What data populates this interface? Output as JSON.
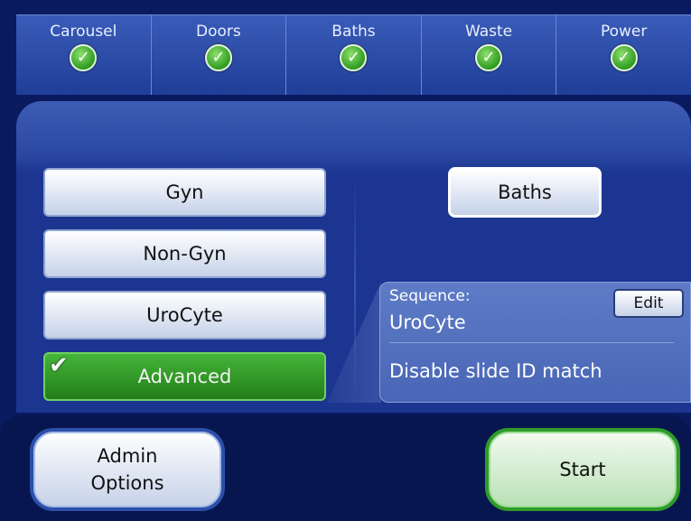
{
  "status_bar": {
    "items": [
      {
        "label": "Carousel",
        "status_icon": "check-circle-icon",
        "status_color": "#2f9b1f"
      },
      {
        "label": "Doors",
        "status_icon": "check-circle-icon",
        "status_color": "#2f9b1f"
      },
      {
        "label": "Baths",
        "status_icon": "check-circle-icon",
        "status_color": "#2f9b1f"
      },
      {
        "label": "Waste",
        "status_icon": "check-circle-icon",
        "status_color": "#2f9b1f"
      },
      {
        "label": "Power",
        "status_icon": "check-circle-icon",
        "status_color": "#2f9b1f"
      }
    ],
    "check_glyph": "✓"
  },
  "modes": {
    "gyn": "Gyn",
    "non_gyn": "Non-Gyn",
    "urocyte": "UroCyte",
    "advanced": "Advanced",
    "advanced_checked": true,
    "advanced_check_glyph": "✔",
    "advanced_color": "#2f9424"
  },
  "baths_button": "Baths",
  "sequence": {
    "label": "Sequence:",
    "value": "UroCyte",
    "edit_label": "Edit",
    "option": "Disable slide ID match"
  },
  "bottom": {
    "admin_line1": "Admin",
    "admin_line2": "Options",
    "start_label": "Start",
    "start_color": "#2f9b2a"
  }
}
